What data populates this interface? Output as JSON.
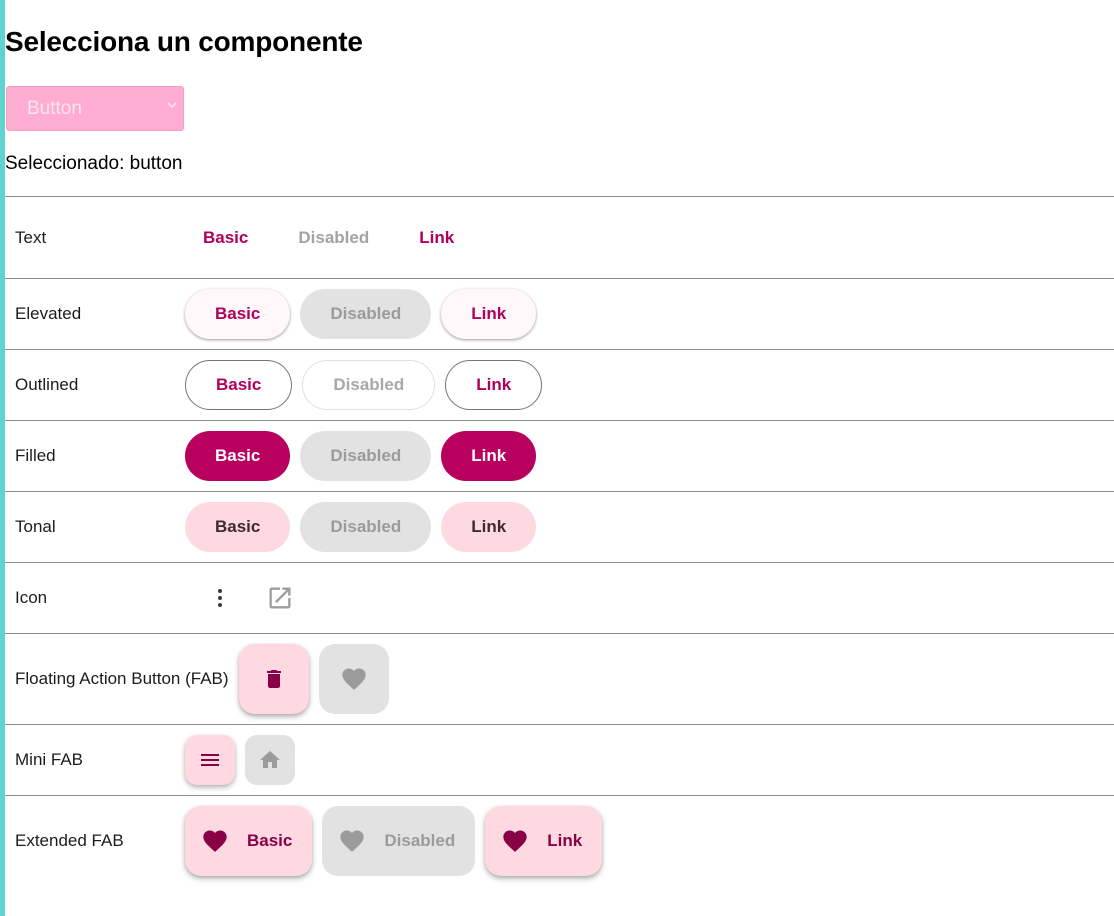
{
  "page": {
    "title": "Selecciona un componente",
    "select": {
      "value": "Button"
    },
    "selected_text": "Seleccionado: button"
  },
  "rows": {
    "text": {
      "label": "Text",
      "buttons": [
        "Basic",
        "Disabled",
        "Link"
      ]
    },
    "elevated": {
      "label": "Elevated",
      "buttons": [
        "Basic",
        "Disabled",
        "Link"
      ]
    },
    "outlined": {
      "label": "Outlined",
      "buttons": [
        "Basic",
        "Disabled",
        "Link"
      ]
    },
    "filled": {
      "label": "Filled",
      "buttons": [
        "Basic",
        "Disabled",
        "Link"
      ]
    },
    "tonal": {
      "label": "Tonal",
      "buttons": [
        "Basic",
        "Disabled",
        "Link"
      ]
    },
    "icon": {
      "label": "Icon",
      "icons": [
        "more-vert-icon",
        "open-in-new-icon"
      ]
    },
    "fab": {
      "label": "Floating Action Button (FAB)",
      "icons": [
        "delete-icon",
        "favorite-icon"
      ]
    },
    "mini_fab": {
      "label": "Mini FAB",
      "icons": [
        "menu-icon",
        "home-icon"
      ]
    },
    "extended_fab": {
      "label": "Extended FAB",
      "buttons": [
        "Basic",
        "Disabled",
        "Link"
      ],
      "icon": "favorite-icon"
    }
  },
  "colors": {
    "primary": "#b8005f",
    "tonal": "#ffd9e2",
    "disabled": "#e2e2e2",
    "accent_bar": "#5fd3d0",
    "select_bg": "#ffacd2"
  }
}
